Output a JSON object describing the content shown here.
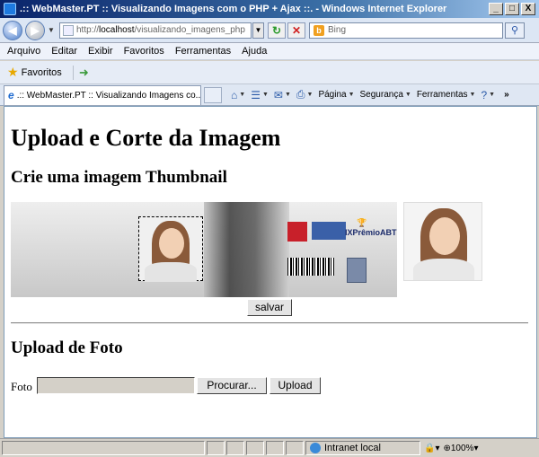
{
  "window": {
    "title": ".:: WebMaster.PT :: Visualizando Imagens com o PHP + Ajax ::. - Windows Internet Explorer",
    "min_btn": "_",
    "max_btn": "□",
    "close_btn": "X"
  },
  "address": {
    "url_prefix": "http://",
    "url_host": "localhost",
    "url_path": "/visualizando_imagens_php",
    "search_placeholder": "Bing"
  },
  "menu": [
    "Arquivo",
    "Editar",
    "Exibir",
    "Favoritos",
    "Ferramentas",
    "Ajuda"
  ],
  "favorites": {
    "label": "Favoritos"
  },
  "tab": {
    "title": ".:: WebMaster.PT :: Visualizando Imagens co..."
  },
  "commands": {
    "page": "Página",
    "security": "Segurança",
    "tools": "Ferramentas",
    "chevron": "»"
  },
  "page": {
    "heading": "Upload e Corte da Imagem",
    "subheading": "Crie uma imagem Thumbnail",
    "save_button": "salvar",
    "upload_heading": "Upload de Foto",
    "foto_label": "Foto",
    "browse_button": "Procurar...",
    "upload_button": "Upload",
    "banner_award": "IXPrêmioABT"
  },
  "status": {
    "zone": "Intranet local",
    "zoom": "100%"
  }
}
